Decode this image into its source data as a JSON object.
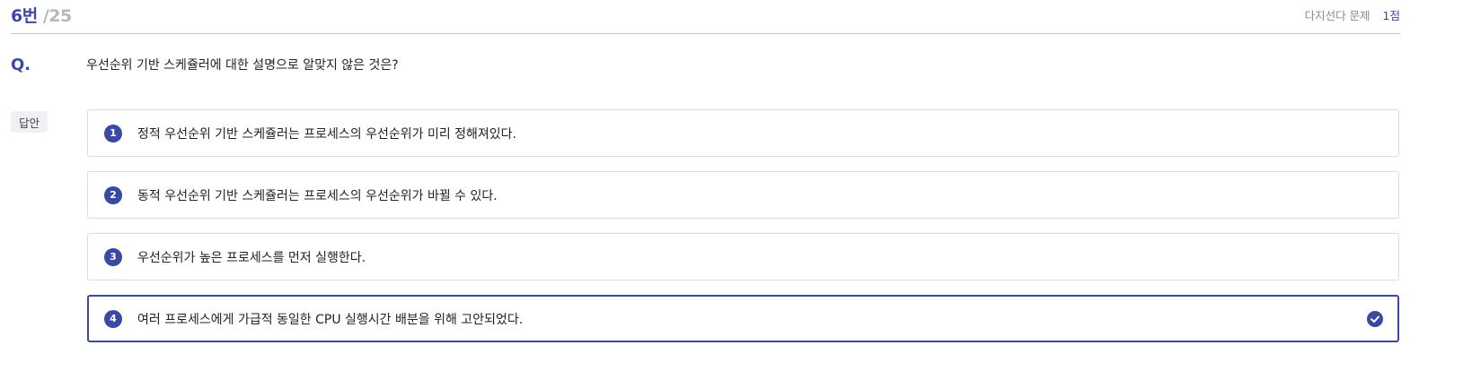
{
  "header": {
    "current": "6번",
    "total": "/25",
    "type": "다지선다 문제",
    "score": "1점"
  },
  "question": {
    "label": "Q.",
    "text": "우선순위 기반 스케쥴러에 대한 설명으로 알맞지 않은 것은?"
  },
  "answer_tag": "답안",
  "options": [
    {
      "num": "1",
      "text": "정적 우선순위 기반 스케쥴러는 프로세스의 우선순위가 미리 정해져있다."
    },
    {
      "num": "2",
      "text": "동적 우선순위 기반 스케쥴러는 프로세스의 우선순위가 바뀔 수 있다."
    },
    {
      "num": "3",
      "text": "우선순위가 높은 프로세스를 먼저 실행한다."
    },
    {
      "num": "4",
      "text": "여러 프로세스에게 가급적 동일한 CPU 실행시간 배분을 위해 고안되었다."
    }
  ],
  "selected_option": "4",
  "colors": {
    "accent": "#3a4aa3",
    "muted": "#b8b8b8",
    "border": "#dcdcdc"
  }
}
